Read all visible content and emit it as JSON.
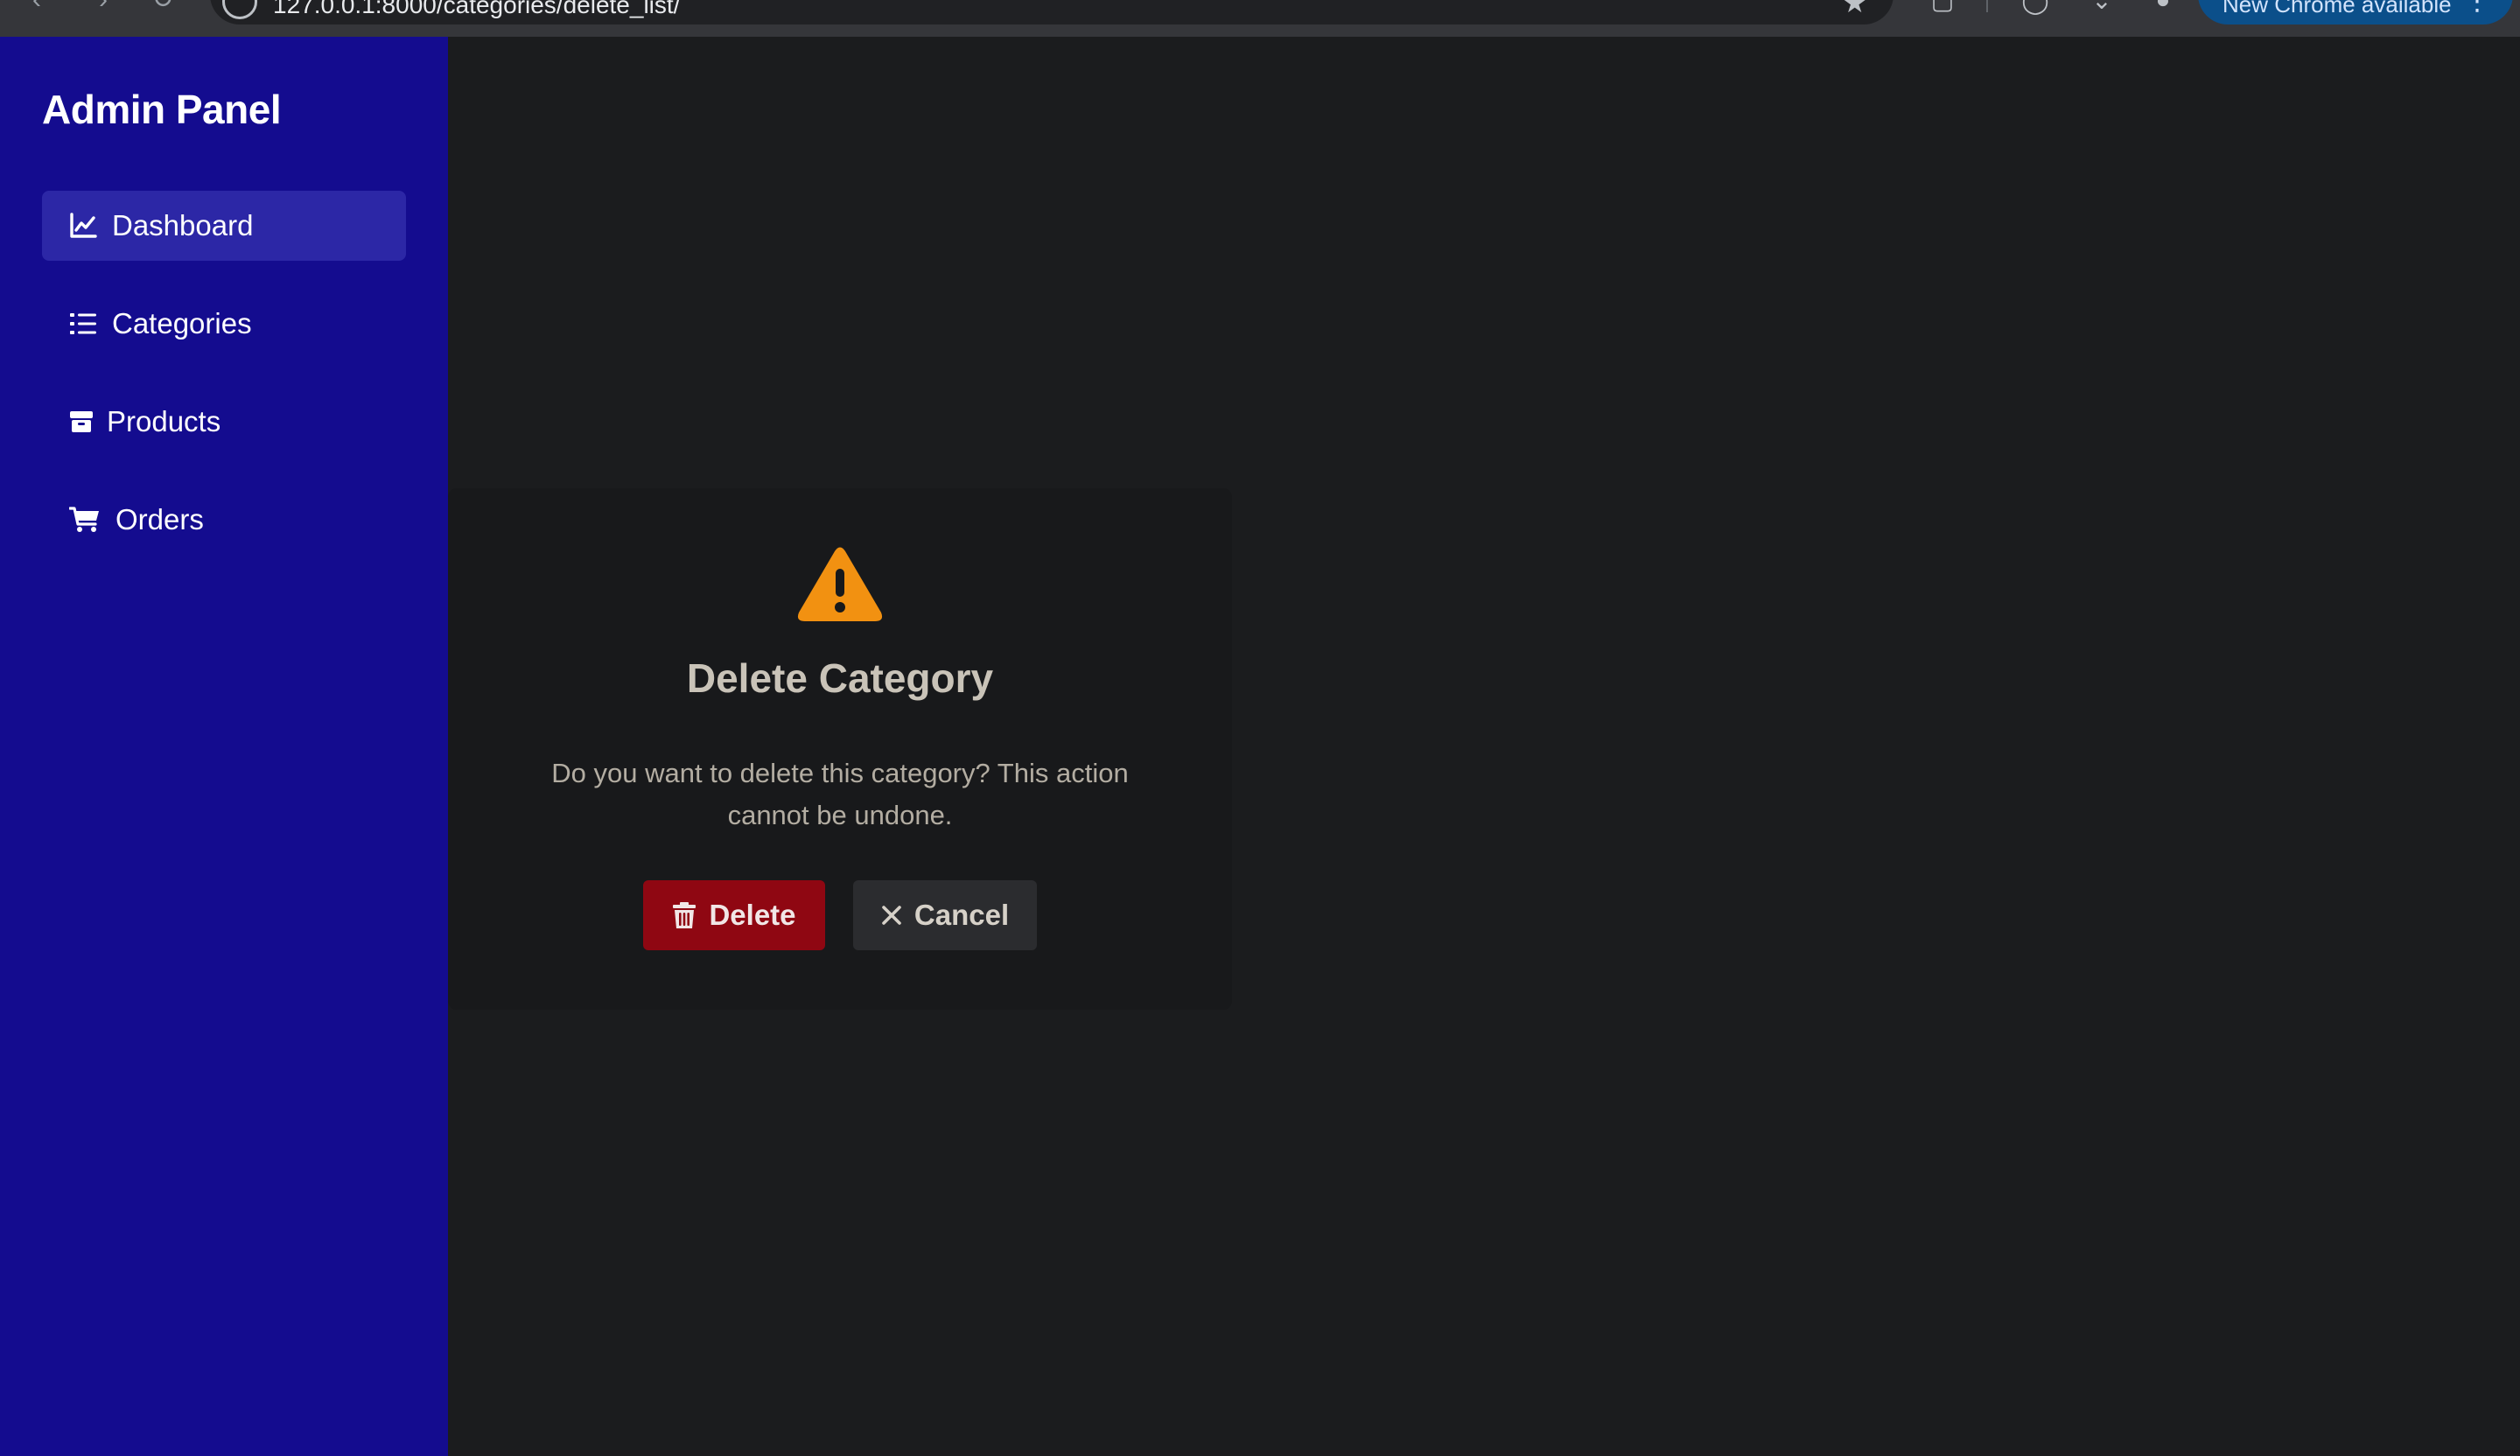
{
  "browser": {
    "url": "127.0.0.1:8000/categories/delete_list/",
    "update_label": "New Chrome available",
    "icons": [
      "back-icon",
      "forward-icon",
      "reload-icon",
      "site-info-icon",
      "bookmark-star-icon",
      "extensions-icon",
      "whatsapp-icon",
      "downloads-icon",
      "profile-icon",
      "menu-dots-icon"
    ]
  },
  "sidebar": {
    "title": "Admin Panel",
    "items": [
      {
        "label": "Dashboard",
        "icon": "chart-line-icon",
        "active": true
      },
      {
        "label": "Categories",
        "icon": "list-icon",
        "active": false
      },
      {
        "label": "Products",
        "icon": "box-icon",
        "active": false
      },
      {
        "label": "Orders",
        "icon": "cart-icon",
        "active": false
      }
    ]
  },
  "dialog": {
    "icon": "warning-triangle-icon",
    "title": "Delete Category",
    "message": "Do you want to delete this category? This action cannot be undone.",
    "delete_label": "Delete",
    "cancel_label": "Cancel"
  },
  "colors": {
    "sidebar_bg": "#140c8f",
    "active_item_bg": "#2c27a6",
    "page_bg": "#1b1c1e",
    "dialog_bg": "#18191b",
    "warning": "#f29111",
    "delete_button": "#8f0712",
    "cancel_button": "#2b2c2f"
  }
}
